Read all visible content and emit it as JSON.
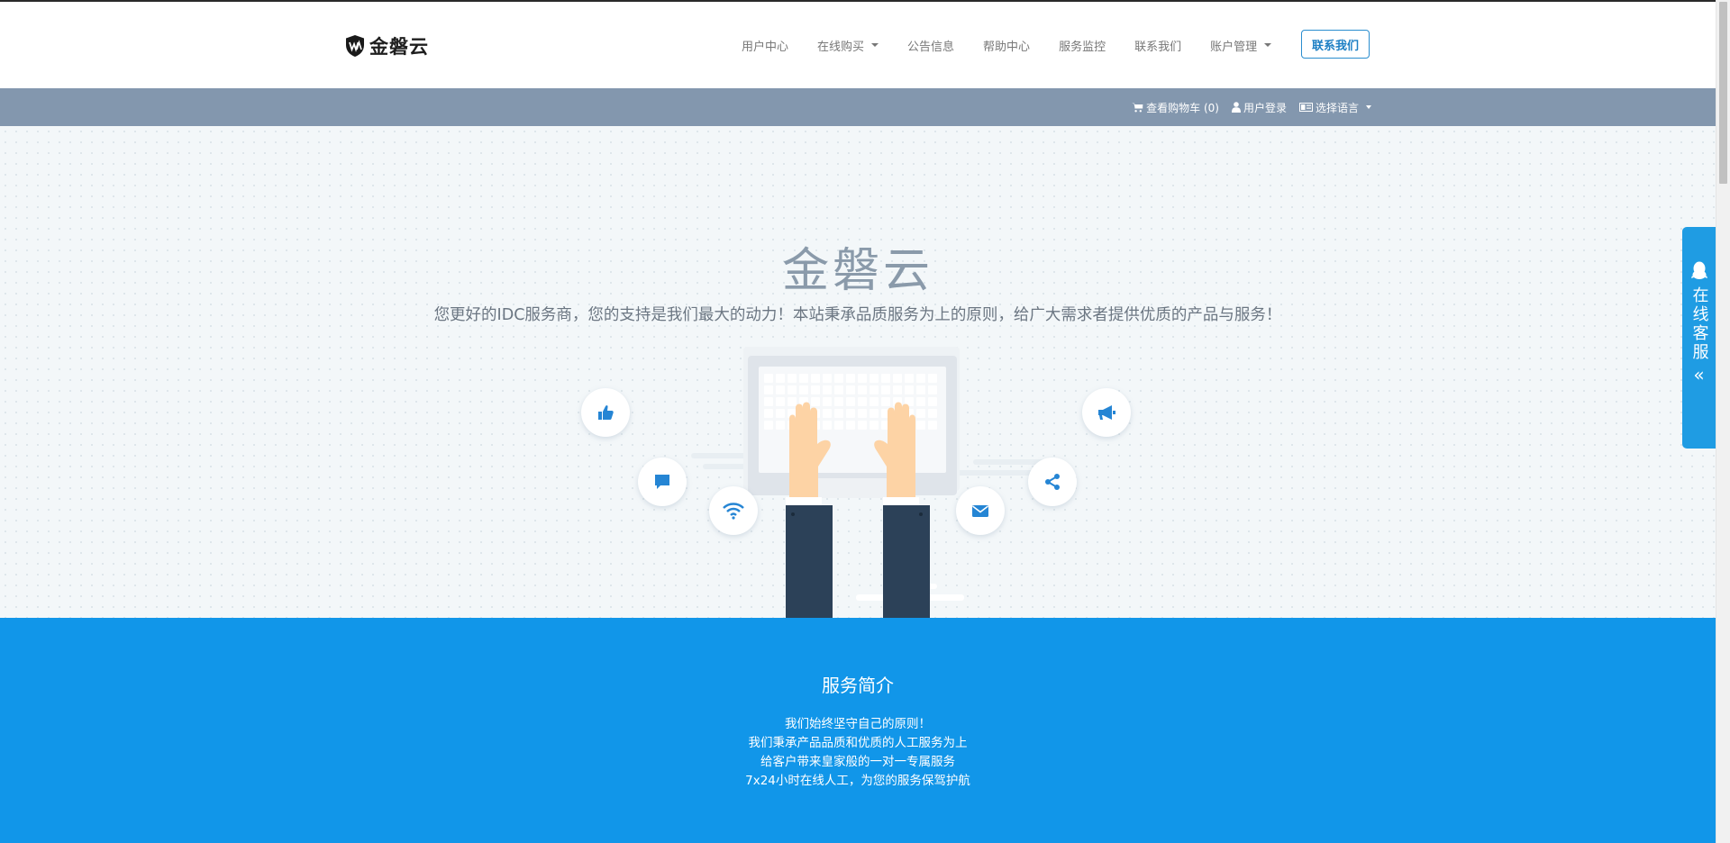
{
  "header": {
    "logo_text": "金磐云",
    "nav": [
      {
        "label": "用户中心",
        "dropdown": false
      },
      {
        "label": "在线购买",
        "dropdown": true
      },
      {
        "label": "公告信息",
        "dropdown": false
      },
      {
        "label": "帮助中心",
        "dropdown": false
      },
      {
        "label": "服务监控",
        "dropdown": false
      },
      {
        "label": "联系我们",
        "dropdown": false
      },
      {
        "label": "账户管理",
        "dropdown": true
      }
    ],
    "contact_button": "联系我们"
  },
  "subbar": {
    "cart_label": "查看购物车 (0)",
    "login_label": "用户登录",
    "language_label": "选择语言"
  },
  "hero": {
    "title": "金磐云",
    "subtitle": "您更好的IDC服务商，您的支持是我们最大的动力！本站秉承品质服务为上的原则，给广大需求者提供优质的产品与服务！",
    "icons": [
      "thumbs-up-icon",
      "comment-icon",
      "wifi-icon",
      "bullhorn-icon",
      "share-icon",
      "envelope-icon"
    ]
  },
  "service": {
    "title": "服务简介",
    "lines": [
      "我们始终坚守自己的原则！",
      "我们秉承产品品质和优质的人工服务为上",
      "给客户带来皇家般的一对一专属服务",
      "7x24小时在线人工，为您的服务保驾护航"
    ]
  },
  "side_tab": {
    "label": "在线客服",
    "arrow": "«"
  },
  "colors": {
    "accent_blue": "#1196e9",
    "subbar_gray": "#8397ae",
    "hero_bg": "#f3f7f9",
    "icon_blue": "#2585d4"
  }
}
